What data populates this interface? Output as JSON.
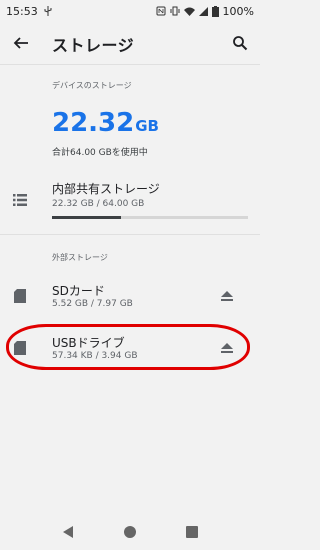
{
  "status_bar": {
    "time": "15:53",
    "battery": "100%"
  },
  "app_bar": {
    "title": "ストレージ"
  },
  "device_storage": {
    "header": "デバイスのストレージ",
    "used_value": "22.32",
    "used_unit": "GB",
    "total_text": "合計64.00 GBを使用中"
  },
  "internal": {
    "title": "内部共有ストレージ",
    "detail": "22.32 GB / 64.00 GB",
    "usage_fraction": 0.35
  },
  "external": {
    "header": "外部ストレージ",
    "items": [
      {
        "title": "SDカード",
        "detail": "5.52 GB / 7.97 GB"
      },
      {
        "title": "USBドライブ",
        "detail": "57.34 KB / 3.94 GB"
      }
    ]
  },
  "colors": {
    "accent": "#1a73e8",
    "highlight": "#e00000"
  },
  "icons": {
    "back": "arrow-back-icon",
    "search": "search-icon",
    "internal": "storage-list-icon",
    "sd": "sd-card-icon",
    "eject": "eject-icon"
  }
}
